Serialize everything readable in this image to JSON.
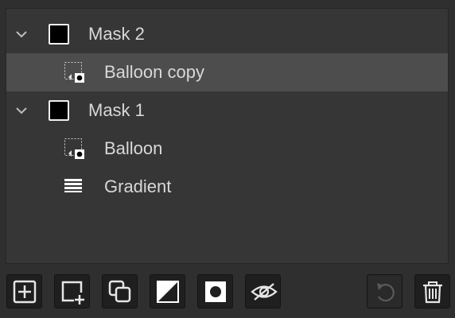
{
  "layers": [
    {
      "type": "group",
      "label": "Mask 2",
      "icon": "chevron-down-icon",
      "swatch_color": "#000000"
    },
    {
      "type": "child",
      "label": "Balloon copy",
      "icon": "shape-layer-icon",
      "selected": true
    },
    {
      "type": "group",
      "label": "Mask 1",
      "icon": "chevron-down-icon",
      "swatch_color": "#000000"
    },
    {
      "type": "child",
      "label": "Balloon",
      "icon": "shape-layer-icon"
    },
    {
      "type": "child",
      "label": "Gradient",
      "icon": "gradient-layer-icon"
    }
  ],
  "toolbar": {
    "buttons": [
      {
        "name": "add-layer-button",
        "icon": "plus-square-icon"
      },
      {
        "name": "add-child-layer-button",
        "icon": "square-plus-corner-icon"
      },
      {
        "name": "duplicate-layer-button",
        "icon": "duplicate-icon"
      },
      {
        "name": "mask-button",
        "icon": "diagonal-half-icon"
      },
      {
        "name": "shape-button",
        "icon": "circle-in-square-icon"
      },
      {
        "name": "visibility-button",
        "icon": "eye-slash-icon"
      },
      {
        "name": "reset-button",
        "icon": "undo-icon",
        "disabled": true
      },
      {
        "name": "delete-button",
        "icon": "trash-icon"
      }
    ]
  },
  "colors": {
    "background": "#2f2f30",
    "panel": "#363637",
    "selected_row": "#4d4d4e",
    "text": "#d8d8d8"
  }
}
